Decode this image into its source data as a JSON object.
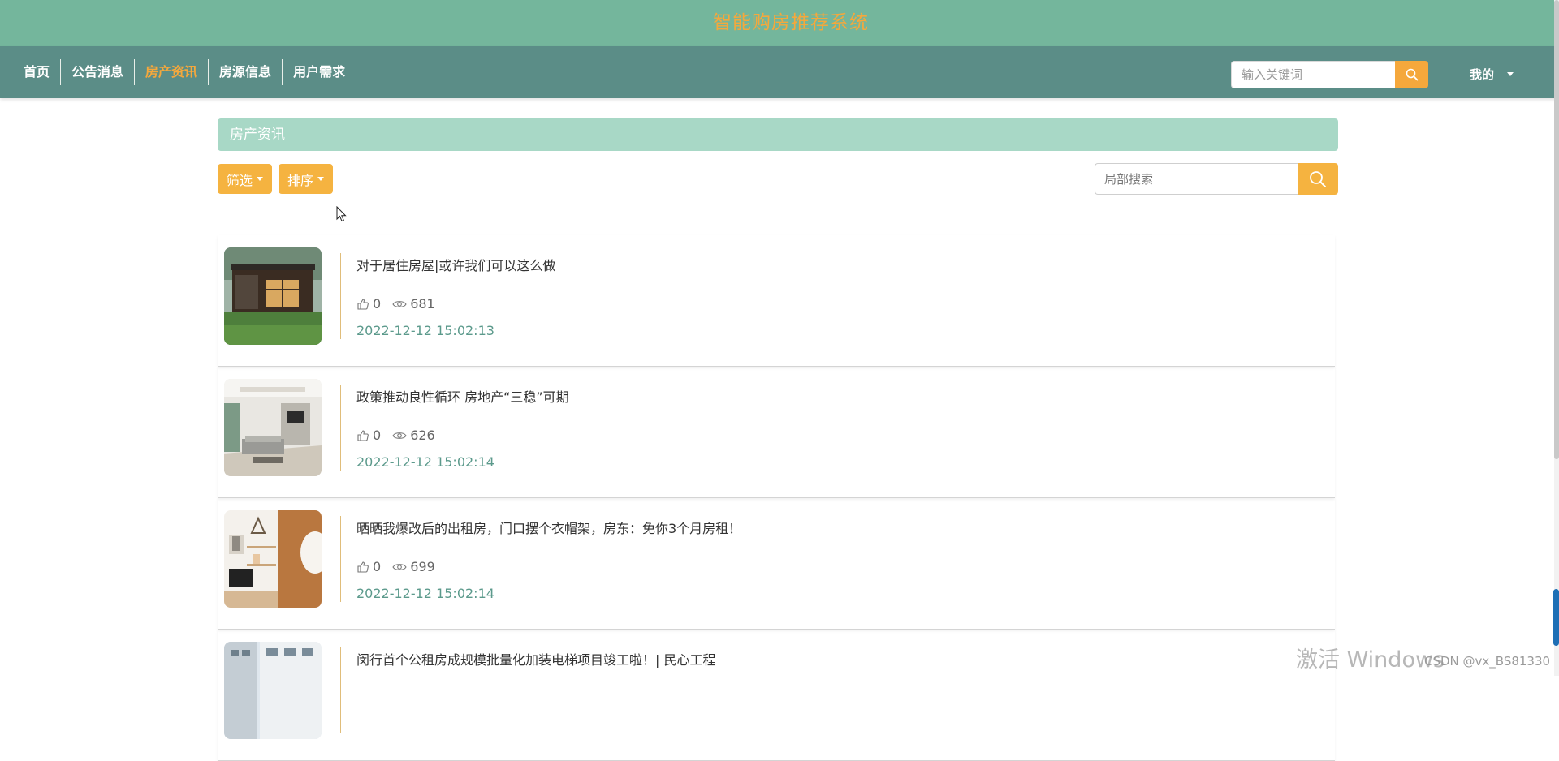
{
  "header": {
    "site_title": "智能购房推荐系统"
  },
  "nav": {
    "items": [
      {
        "label": "首页"
      },
      {
        "label": "公告消息"
      },
      {
        "label": "房产资讯",
        "active": true
      },
      {
        "label": "房源信息"
      },
      {
        "label": "用户需求"
      }
    ],
    "search_placeholder": "输入关键词",
    "user_label": "我的"
  },
  "section": {
    "title": "房产资讯"
  },
  "toolbar": {
    "filter_label": "筛选",
    "sort_label": "排序",
    "search_placeholder": "局部搜索"
  },
  "news": [
    {
      "title": "对于居住房屋|或许我们可以这么做",
      "likes": "0",
      "views": "681",
      "date": "2022-12-12 15:02:13",
      "thumb": "house-exterior"
    },
    {
      "title": "政策推动良性循环 房地产“三稳”可期",
      "likes": "0",
      "views": "626",
      "date": "2022-12-12 15:02:14",
      "thumb": "living-room"
    },
    {
      "title": "晒晒我爆改后的出租房，门口摆个衣帽架，房东：免你3个月房租！",
      "likes": "0",
      "views": "699",
      "date": "2022-12-12 15:02:14",
      "thumb": "room-decor"
    },
    {
      "title": "闵行首个公租房成规模批量化加装电梯项目竣工啦！| 民心工程",
      "likes": "",
      "views": "",
      "date": "",
      "thumb": "apartment-building"
    }
  ],
  "overlay": {
    "watermark": "激活 Windows",
    "csdn": "CSDN @vx_BS81330"
  },
  "colors": {
    "titlebar": "#74b69c",
    "navbar": "#5b8d87",
    "accent": "#f5a83c",
    "section_header": "#a8d8c6",
    "date": "#5c9a8c"
  }
}
